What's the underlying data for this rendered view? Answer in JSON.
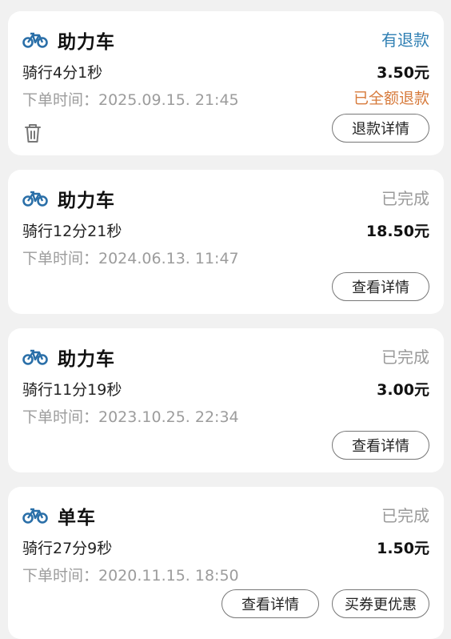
{
  "orders": [
    {
      "title": "助力车",
      "status": "有退款",
      "ride": "骑行4分1秒",
      "amount": "3.50元",
      "order_time": "下单时间：2025.09.15. 21:45",
      "refund_note": "已全额退款",
      "button": "退款详情",
      "icons": [
        "bike-icon",
        "trash-icon"
      ],
      "accent": "#2f7fb3",
      "refund_color": "#d77b3c"
    },
    {
      "title": "助力车",
      "status": "已完成",
      "ride": "骑行12分21秒",
      "amount": "18.50元",
      "order_time": "下单时间：2024.06.13. 11:47",
      "button": "查看详情"
    },
    {
      "title": "助力车",
      "status": "已完成",
      "ride": "骑行11分19秒",
      "amount": "3.00元",
      "order_time": "下单时间：2023.10.25. 22:34",
      "button": "查看详情"
    },
    {
      "title": "单车",
      "status": "已完成",
      "ride": "骑行27分9秒",
      "amount": "1.50元",
      "order_time": "下单时间：2020.11.15. 18:50",
      "button": "查看详情",
      "button2": "买券更优惠"
    }
  ]
}
